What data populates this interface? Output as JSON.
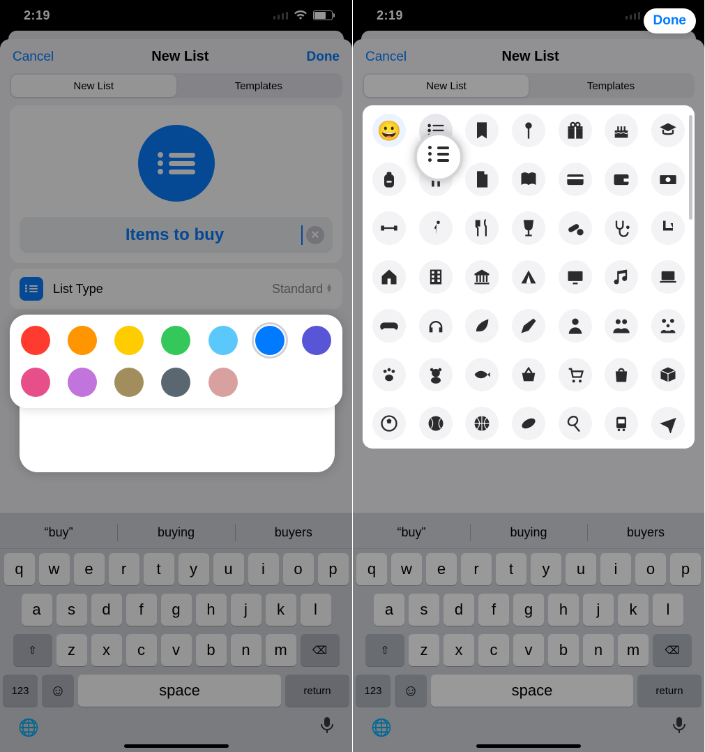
{
  "status": {
    "time": "2:19"
  },
  "nav": {
    "cancel": "Cancel",
    "title": "New List",
    "done": "Done"
  },
  "tabs": {
    "newList": "New List",
    "templates": "Templates"
  },
  "listName": {
    "value": "Items to buy"
  },
  "listType": {
    "label": "List Type",
    "value": "Standard"
  },
  "colors": [
    {
      "name": "red",
      "hex": "#ff3b30",
      "selected": false
    },
    {
      "name": "orange",
      "hex": "#ff9500",
      "selected": false
    },
    {
      "name": "yellow",
      "hex": "#ffcc00",
      "selected": false
    },
    {
      "name": "green",
      "hex": "#34c759",
      "selected": false
    },
    {
      "name": "lightblue",
      "hex": "#5ac8fa",
      "selected": false
    },
    {
      "name": "blue",
      "hex": "#007aff",
      "selected": true
    },
    {
      "name": "indigo",
      "hex": "#5856d6",
      "selected": false
    },
    {
      "name": "pink",
      "hex": "#e74f8b",
      "selected": false
    },
    {
      "name": "purple",
      "hex": "#c074dc",
      "selected": false
    },
    {
      "name": "brown",
      "hex": "#a28e5c",
      "selected": false
    },
    {
      "name": "slate",
      "hex": "#5b6770",
      "selected": false
    },
    {
      "name": "rose",
      "hex": "#d9a0a0",
      "selected": false
    }
  ],
  "icons": [
    "emoji",
    "list",
    "bookmark",
    "pin",
    "gift",
    "birthday",
    "graduation",
    "backpack",
    "pencil-ruler",
    "document",
    "book",
    "credit-card",
    "wallet",
    "money",
    "dumbbell",
    "running",
    "fork-knife",
    "wineglass",
    "pills",
    "stethoscope",
    "chair",
    "house",
    "building",
    "museum",
    "tent",
    "tv",
    "music",
    "laptop",
    "game-controller",
    "headphones",
    "leaf",
    "pen",
    "person",
    "people",
    "family",
    "paw",
    "teddy-bear",
    "fish",
    "basket",
    "shopping-cart",
    "shopping-bag",
    "box",
    "soccer",
    "baseball",
    "basketball",
    "football",
    "tennis",
    "tram",
    "airplane"
  ],
  "selectedIcon": "list",
  "suggestions": [
    "“buy”",
    "buying",
    "buyers"
  ],
  "keyboard": {
    "row1": [
      "q",
      "w",
      "e",
      "r",
      "t",
      "y",
      "u",
      "i",
      "o",
      "p"
    ],
    "row2": [
      "a",
      "s",
      "d",
      "f",
      "g",
      "h",
      "j",
      "k",
      "l"
    ],
    "row3": [
      "z",
      "x",
      "c",
      "v",
      "b",
      "n",
      "m"
    ],
    "numKey": "123",
    "space": "space",
    "return": "return"
  }
}
